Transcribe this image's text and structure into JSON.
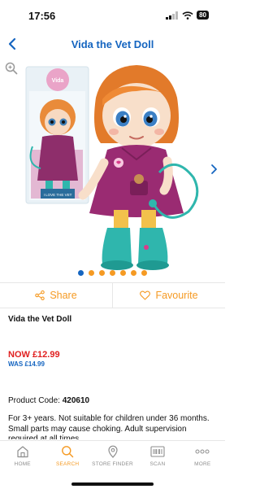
{
  "status": {
    "time": "17:56",
    "battery": "80"
  },
  "nav": {
    "title": "Vida the Vet Doll"
  },
  "gallery": {
    "box_brand": "Vida",
    "box_caption": "I LOVE THE VET",
    "images_count": 7,
    "active_index": 0
  },
  "actions": {
    "share": "Share",
    "favourite": "Favourite"
  },
  "product": {
    "name": "Vida the Vet Doll",
    "now_price": "NOW £12.99",
    "was_price": "WAS £14.99",
    "code_label": "Product Code: ",
    "code": "420610",
    "description": "For 3+ years. Not suitable for children under 36 months. Small parts may cause choking. Adult supervision required at all times."
  },
  "tabs": [
    {
      "label": "HOME",
      "icon": "home-icon",
      "active": false
    },
    {
      "label": "SEARCH",
      "icon": "search-icon",
      "active": true
    },
    {
      "label": "STORE FINDER",
      "icon": "location-pin-icon",
      "active": false
    },
    {
      "label": "SCAN",
      "icon": "barcode-icon",
      "active": false
    },
    {
      "label": "MORE",
      "icon": "more-dots-icon",
      "active": false
    }
  ],
  "colors": {
    "accent": "#f59a23",
    "brand_blue": "#1565c0",
    "price_red": "#e02020"
  }
}
